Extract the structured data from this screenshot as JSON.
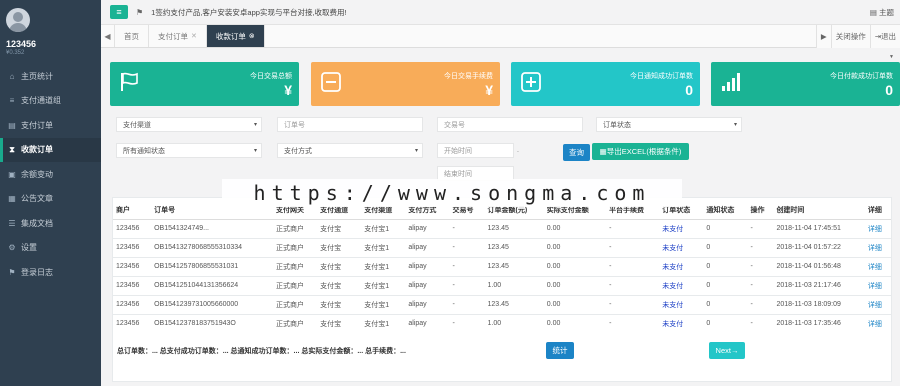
{
  "sidebar": {
    "user_name": "123456",
    "user_sub": "¥0.352",
    "items": [
      {
        "icon": "home-icon",
        "glyph": "⌂",
        "label": "主页统计"
      },
      {
        "icon": "bank-icon",
        "glyph": "≡",
        "label": "支付通道组"
      },
      {
        "icon": "list-icon",
        "glyph": "▤",
        "label": "支付订单"
      },
      {
        "icon": "hourglass-icon",
        "glyph": "⧗",
        "label": "收款订单"
      },
      {
        "icon": "money-icon",
        "glyph": "▣",
        "label": "余额变动"
      },
      {
        "icon": "article-icon",
        "glyph": "▦",
        "label": "公告文章"
      },
      {
        "icon": "doc-icon",
        "glyph": "☰",
        "label": "集成文档"
      },
      {
        "icon": "gear-icon",
        "glyph": "⚙",
        "label": "设置"
      },
      {
        "icon": "log-icon",
        "glyph": "⚑",
        "label": "登录日志"
      }
    ]
  },
  "topbar": {
    "notice": "1签约支付产品,客户安装安卓app实现与平台对接,收取费用!",
    "theme": "主题"
  },
  "tabs": {
    "items": [
      "首页",
      "支付订单",
      "收款订单"
    ],
    "close": "关闭操作",
    "exit": "退出"
  },
  "cards": [
    {
      "label": "今日交易总额",
      "value": "¥"
    },
    {
      "label": "今日交易手续费",
      "value": "¥"
    },
    {
      "label": "今日通知成功订单数",
      "value": "0"
    },
    {
      "label": "今日付款成功订单数",
      "value": "0"
    }
  ],
  "filters": {
    "channel": "支付渠道",
    "order_no": "订单号",
    "trade_no": "交易号",
    "order_status": "订单状态",
    "notify_status": "所有通知状态",
    "pay_method": "支付方式",
    "start_time": "开始时间",
    "end_time": "结束时间",
    "dot": ".",
    "query_btn": "查询",
    "export_btn": "导出EXCEL(根据条件)"
  },
  "table": {
    "headers": [
      "商户",
      "订单号",
      "支付网关",
      "支付通道",
      "支付渠道",
      "支付方式",
      "交易号",
      "订单金额(元)",
      "实际支付金额",
      "平台手续费",
      "订单状态",
      "通知状态",
      "操作",
      "创建时间",
      "详细"
    ],
    "rows": [
      [
        "123456",
        "OB1541324749...",
        "正式商户",
        "支付宝",
        "支付宝1",
        "alipay",
        "-",
        "123.45",
        "0.00",
        "-",
        "未支付",
        "0",
        "-",
        "2018-11-04 17:45:51",
        "详细"
      ],
      [
        "123456",
        "OB15413278068555310334",
        "正式商户",
        "支付宝",
        "支付宝1",
        "alipay",
        "-",
        "123.45",
        "0.00",
        "-",
        "未支付",
        "0",
        "-",
        "2018-11-04 01:57:22",
        "详细"
      ],
      [
        "123456",
        "OB1541257806855531031",
        "正式商户",
        "支付宝",
        "支付宝1",
        "alipay",
        "-",
        "123.45",
        "0.00",
        "-",
        "未支付",
        "0",
        "-",
        "2018-11-04 01:56:48",
        "详细"
      ],
      [
        "123456",
        "OB1541251044131356624",
        "正式商户",
        "支付宝",
        "支付宝1",
        "alipay",
        "-",
        "1.00",
        "0.00",
        "-",
        "未支付",
        "0",
        "-",
        "2018-11-03 21:17:46",
        "详细"
      ],
      [
        "123456",
        "OB1541239731005660000",
        "正式商户",
        "支付宝",
        "支付宝1",
        "alipay",
        "-",
        "123.45",
        "0.00",
        "-",
        "未支付",
        "0",
        "-",
        "2018-11-03 18:09:09",
        "详细"
      ],
      [
        "123456",
        "OB15412378183751943O",
        "正式商户",
        "支付宝",
        "支付宝1",
        "alipay",
        "-",
        "1.00",
        "0.00",
        "-",
        "未支付",
        "0",
        "-",
        "2018-11-03 17:35:46",
        "详细"
      ]
    ]
  },
  "footer": {
    "summary": "总订单数：... 总支付成功订单数：... 总通知成功订单数：... 总实际支付金额：... 总手续费：...",
    "stat_btn": "统计",
    "next_btn": "Next→"
  },
  "watermark": "https://www.songma.com"
}
